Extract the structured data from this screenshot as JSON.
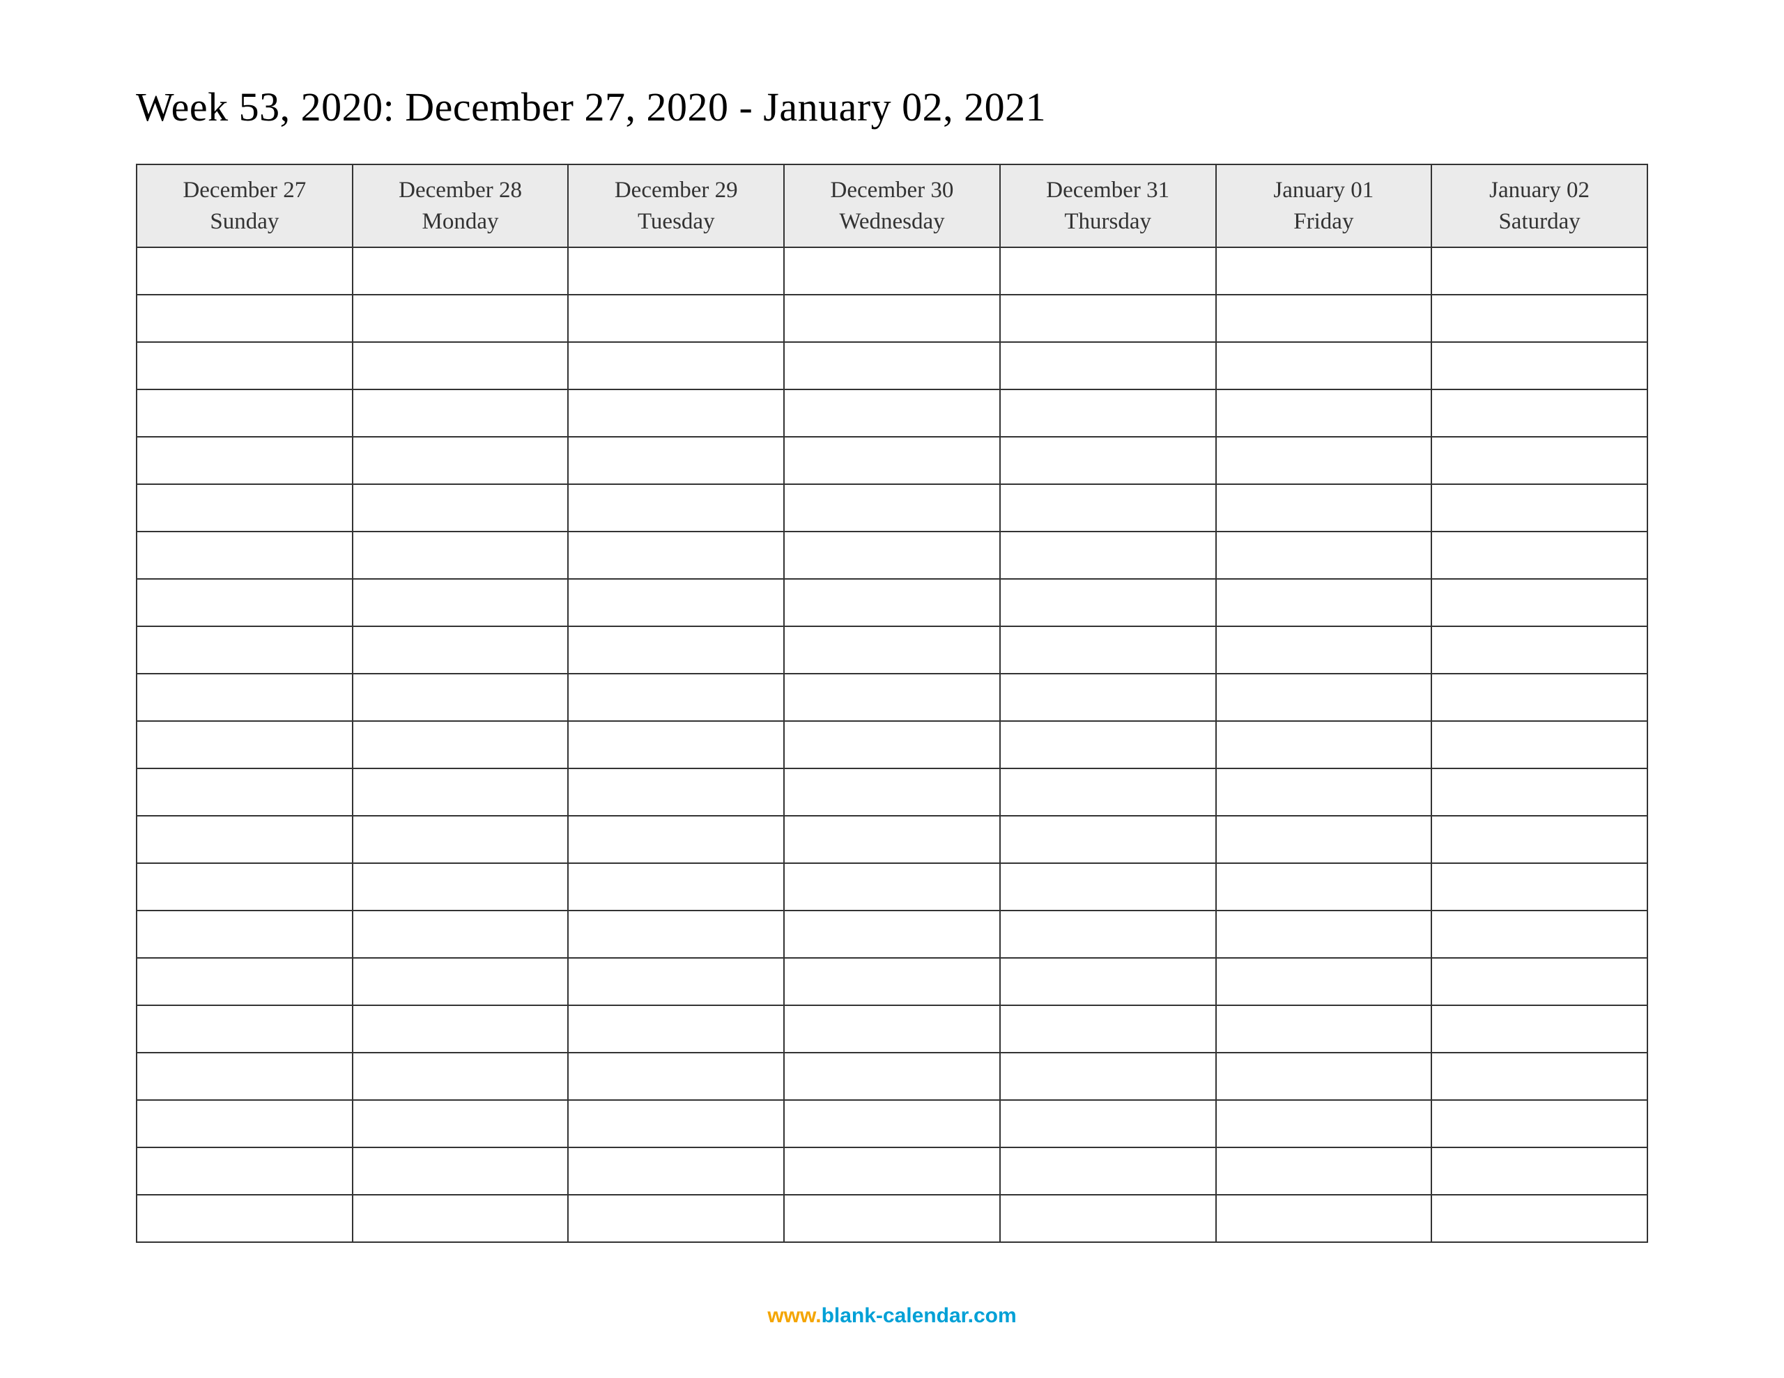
{
  "title": "Week 53, 2020: December 27, 2020 - January 02, 2021",
  "days": [
    {
      "date": "December 27",
      "weekday": "Sunday"
    },
    {
      "date": "December 28",
      "weekday": "Monday"
    },
    {
      "date": "December 29",
      "weekday": "Tuesday"
    },
    {
      "date": "December 30",
      "weekday": "Wednesday"
    },
    {
      "date": "December 31",
      "weekday": "Thursday"
    },
    {
      "date": "January 01",
      "weekday": "Friday"
    },
    {
      "date": "January 02",
      "weekday": "Saturday"
    }
  ],
  "rows_count": 21,
  "footer": {
    "prefix": "www.",
    "domain": "blank-calendar.com"
  }
}
